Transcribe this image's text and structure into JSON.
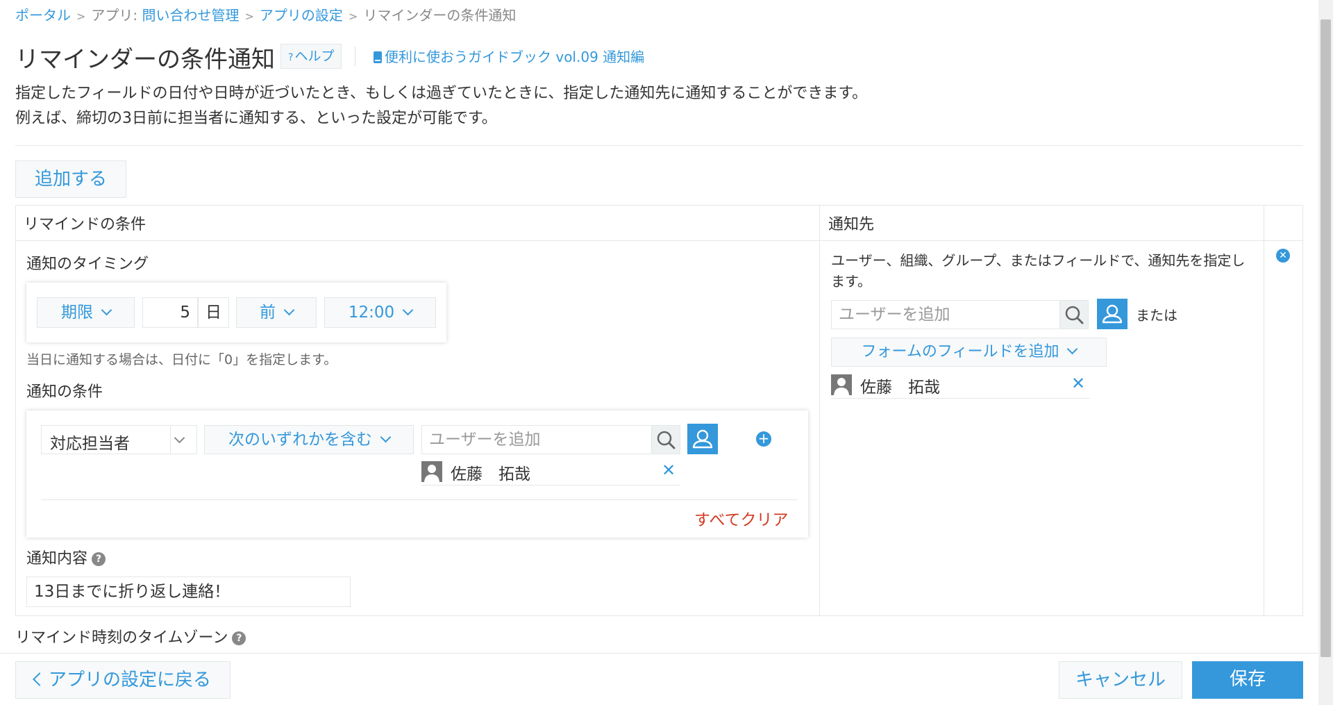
{
  "breadcrumb": {
    "portal": "ポータル",
    "app_prefix": "アプリ:",
    "app_name": "問い合わせ管理",
    "settings": "アプリの設定",
    "current": "リマインダーの条件通知",
    "sep": ">"
  },
  "page": {
    "title": "リマインダーの条件通知",
    "help_q": "?",
    "help_label": "ヘルプ",
    "guide_link": "便利に使おうガイドブック vol.09 通知編",
    "desc_line1": "指定したフィールドの日付や日時が近づいたとき、もしくは過ぎていたときに、指定した通知先に通知することができます。",
    "desc_line2": "例えば、締切の3日前に担当者に通知する、といった設定が可能です。"
  },
  "add_button": "追加する",
  "table": {
    "col_condition": "リマインドの条件",
    "col_recipient": "通知先"
  },
  "timing": {
    "label": "通知のタイミング",
    "field_select": "期限",
    "days_value": "5",
    "days_unit": "日",
    "before_after": "前",
    "time": "12:00",
    "note": "当日に通知する場合は、日付に「0」を指定します。"
  },
  "condition": {
    "label": "通知の条件",
    "field_select": "対応担当者",
    "operator_select": "次のいずれかを含む",
    "user_placeholder": "ユーザーを追加",
    "selected_user": "佐藤　拓哉",
    "clear_all": "すべてクリア"
  },
  "content": {
    "label": "通知内容",
    "value": "13日までに折り返し連絡！"
  },
  "recipient": {
    "desc_line1": "ユーザー、組織、グループ、またはフィールドで、通知先を指定し",
    "desc_line2": "ます。",
    "user_placeholder": "ユーザーを追加",
    "or_text": "または",
    "form_field_button": "フォームのフィールドを追加",
    "selected_user": "佐藤　拓哉"
  },
  "timezone_label": "リマインド時刻のタイムゾーン",
  "footer": {
    "back_button": "アプリの設定に戻る",
    "cancel_button": "キャンセル",
    "save_button": "保存"
  },
  "colors": {
    "accent": "#3498db",
    "danger": "#d03b23",
    "border": "#e3e7e8"
  },
  "icons": [
    "search-icon",
    "user-icon",
    "book-icon",
    "help-icon",
    "plus-icon",
    "close-icon",
    "chevron-down-icon",
    "chevron-left-icon"
  ]
}
